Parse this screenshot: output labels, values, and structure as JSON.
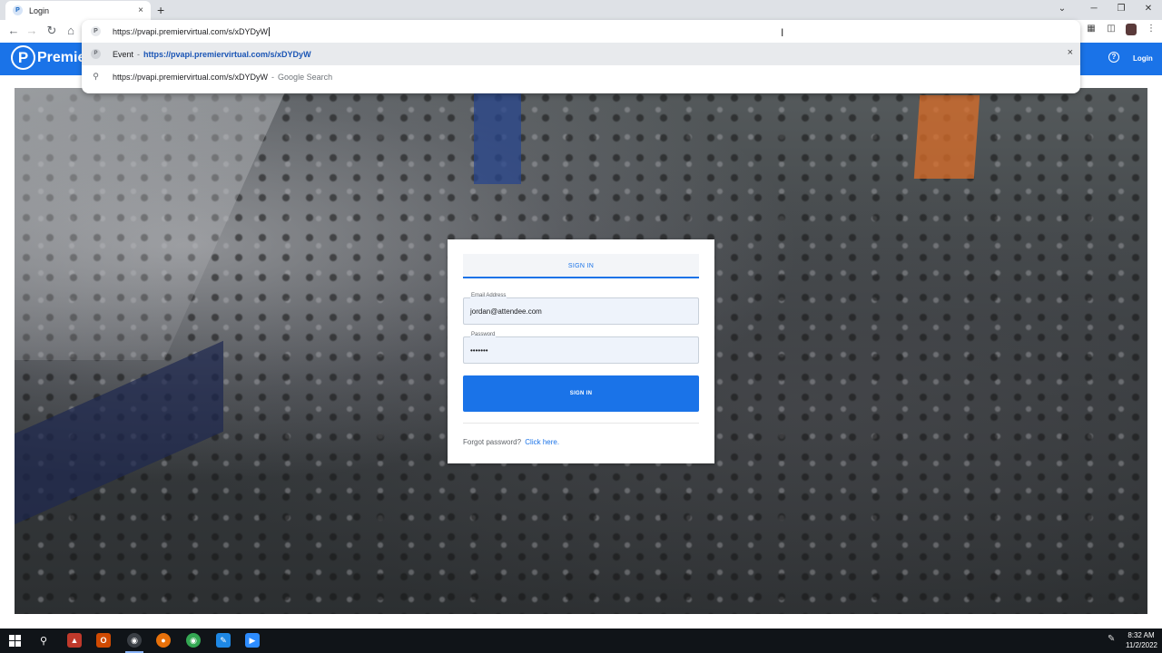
{
  "browser": {
    "tab_title": "Login",
    "favicon_letter": "P",
    "new_tab_symbol": "+",
    "tab_close_symbol": "×",
    "window_controls": {
      "tabs_dropdown": "⌄",
      "minimize": "─",
      "restore": "❐",
      "close": "✕"
    },
    "nav": {
      "back": "←",
      "forward": "→",
      "reload": "↻",
      "home": "⌂"
    },
    "omnibox": {
      "typed_text": "https://pvapi.premiervirtual.com/s/xDYDyW",
      "suggestions": [
        {
          "label": "Event",
          "separator": "-",
          "url": "https://pvapi.premiervirtual.com/s/xDYDyW",
          "remove_symbol": "×"
        },
        {
          "query": "https://pvapi.premiervirtual.com/s/xDYDyW",
          "separator": "-",
          "source": "Google Search"
        }
      ]
    },
    "extension_icons": [
      "puzzle-icon",
      "sidepanel-icon",
      "profile-avatar",
      "menu-kebab-icon"
    ]
  },
  "app": {
    "brand": {
      "mark": "P",
      "name": "Premie"
    },
    "header": {
      "help_symbol": "?",
      "login_label": "Login"
    },
    "signin": {
      "tab_label": "SIGN IN",
      "email_label": "Email Address",
      "email_value": "jordan@attendee.com",
      "password_label": "Password",
      "password_value": "•••••••",
      "button_label": "SIGN IN",
      "forgot_text": "Forgot password?",
      "forgot_link": "Click here."
    }
  },
  "taskbar": {
    "apps": [
      "windows-start-icon",
      "search-icon",
      "app-icon",
      "office-icon",
      "chrome-icon",
      "firefox-icon",
      "chrome-profile-icon",
      "app-icon-2",
      "zoom-icon"
    ],
    "time": "8:32 AM",
    "date": "11/2/2022"
  },
  "colors": {
    "brand_blue": "#1a73e8",
    "taskbar_bg": "#101418",
    "link_blue": "#1a55b5"
  }
}
